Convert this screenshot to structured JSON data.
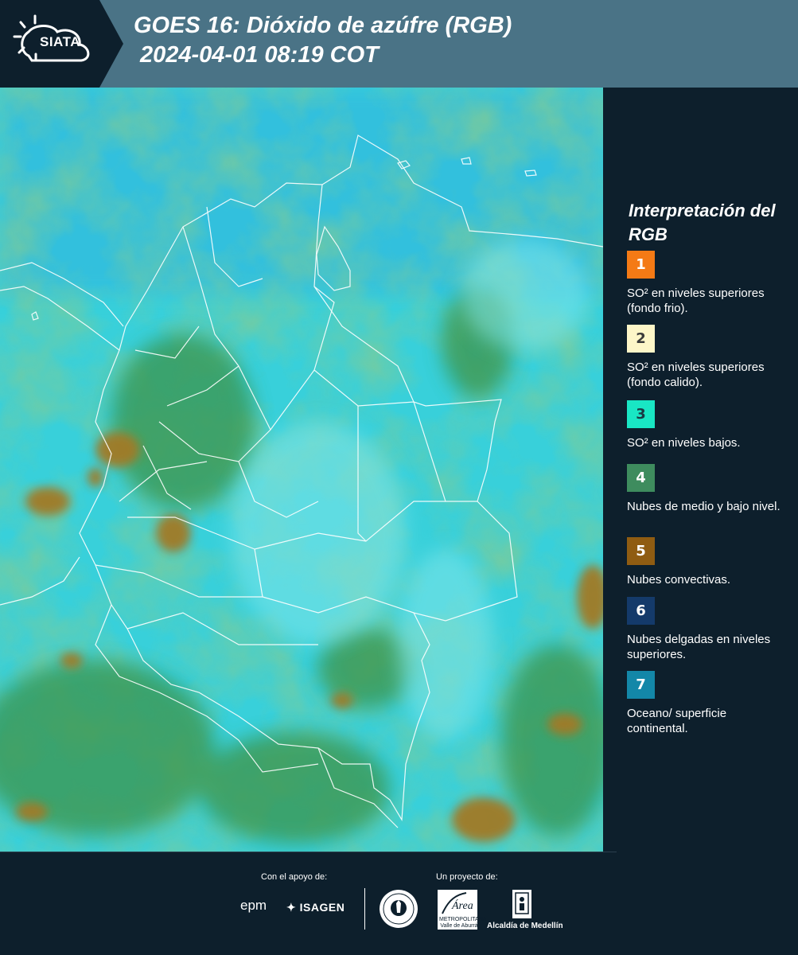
{
  "header": {
    "logo_text": "SIATA",
    "title_line1": "GOES 16: Dióxido de azúfre (RGB)",
    "title_line2": "2024-04-01 08:19 COT"
  },
  "legend": {
    "title": "Interpretación del RGB",
    "items": [
      {
        "number": "1",
        "label": "SO² en niveles superiores (fondo frio).",
        "color": "#f47a15",
        "text_color": "#ffffff"
      },
      {
        "number": "2",
        "label": "SO² en niveles superiores (fondo calido).",
        "color": "#fdf6c8",
        "text_color": "#3a3a3a"
      },
      {
        "number": "3",
        "label": "SO² en niveles bajos.",
        "color": "#19e6c4",
        "text_color": "#1a3a44"
      },
      {
        "number": "4",
        "label": "Nubes de medio y bajo nivel.",
        "color": "#3e8c5e",
        "text_color": "#ffffff"
      },
      {
        "number": "5",
        "label": "Nubes convectivas.",
        "color": "#8f5c12",
        "text_color": "#ffffff"
      },
      {
        "number": "6",
        "label": "Nubes delgadas en niveles superiores.",
        "color": "#143a6a",
        "text_color": "#ffffff"
      },
      {
        "number": "7",
        "label": "Oceano/ superficie continental.",
        "color": "#1387a8",
        "text_color": "#ffffff"
      }
    ]
  },
  "footer": {
    "support_label": "Con el apoyo de:",
    "project_label": "Un proyecto de:",
    "sponsors": [
      "epm",
      "ISAGEN"
    ],
    "partners": {
      "area_name": "Área",
      "area_sub": "METROPOLITANA Valle de Aburrá",
      "alcaldia": "Alcaldía de Medellín"
    }
  },
  "colors": {
    "header_bg": "#4a7386",
    "dark_bg": "#0d1f2c",
    "cyan": "#3ad6dc",
    "green": "#3f9a4f",
    "brown": "#a07a2c"
  }
}
